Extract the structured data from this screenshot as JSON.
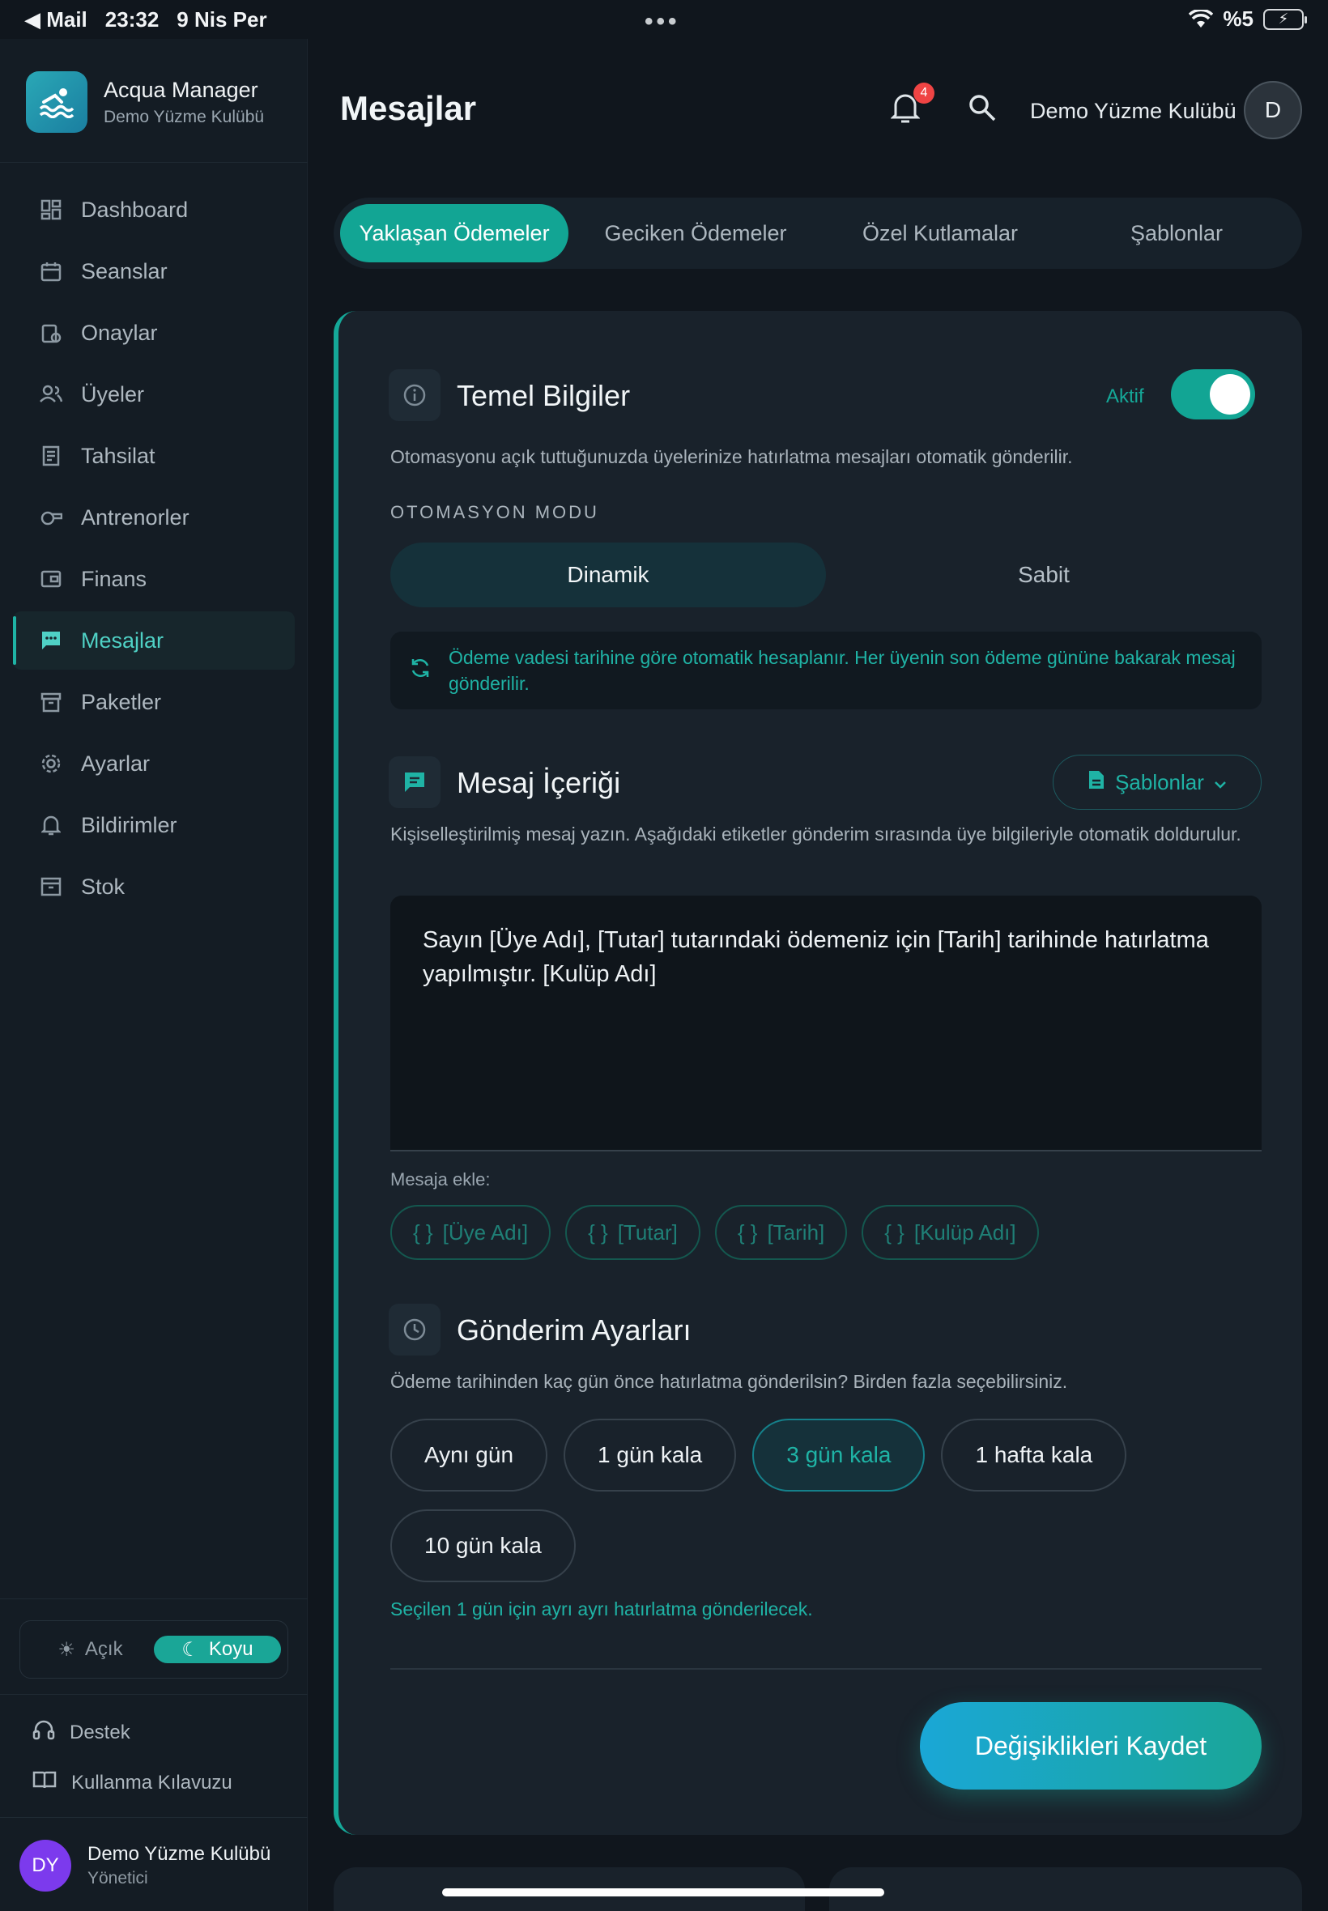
{
  "status_bar": {
    "back_app": "Mail",
    "time": "23:32",
    "date": "9 Nis Per",
    "battery": "%5"
  },
  "brand": {
    "title": "Acqua Manager",
    "subtitle": "Demo Yüzme Kulübü"
  },
  "sidebar": {
    "items": [
      {
        "label": "Dashboard",
        "icon": "dashboard-icon"
      },
      {
        "label": "Seanslar",
        "icon": "calendar-icon"
      },
      {
        "label": "Onaylar",
        "icon": "clipboard-icon"
      },
      {
        "label": "Üyeler",
        "icon": "users-icon"
      },
      {
        "label": "Tahsilat",
        "icon": "receipt-icon"
      },
      {
        "label": "Antrenorler",
        "icon": "whistle-icon"
      },
      {
        "label": "Finans",
        "icon": "wallet-icon"
      },
      {
        "label": "Mesajlar",
        "icon": "message-icon",
        "active": true
      },
      {
        "label": "Paketler",
        "icon": "archive-icon"
      },
      {
        "label": "Ayarlar",
        "icon": "gear-icon"
      },
      {
        "label": "Bildirimler",
        "icon": "bell-icon"
      },
      {
        "label": "Stok",
        "icon": "box-icon"
      }
    ],
    "theme": {
      "light": "Açık",
      "dark": "Koyu",
      "selected": "Koyu"
    },
    "support": "Destek",
    "guide": "Kullanma Kılavuzu",
    "user": {
      "initials": "DY",
      "name": "Demo Yüzme Kulübü",
      "role": "Yönetici"
    }
  },
  "header": {
    "title": "Mesajlar",
    "notification_count": "4",
    "club_name": "Demo Yüzme Kulübü",
    "avatar_initial": "D"
  },
  "tabs": [
    "Yaklaşan Ödemeler",
    "Geciken Ödemeler",
    "Özel Kutlamalar",
    "Şablonlar"
  ],
  "active_tab": "Yaklaşan Ödemeler",
  "basic_info": {
    "title": "Temel Bilgiler",
    "toggle_label": "Aktif",
    "toggle_on": true,
    "description": "Otomasyonu açık tuttuğunuzda üyelerinize hatırlatma mesajları otomatik gönderilir.",
    "mode_label": "OTOMASYON MODU",
    "modes": [
      "Dinamik",
      "Sabit"
    ],
    "selected_mode": "Dinamik",
    "info": "Ödeme vadesi tarihine göre otomatik hesaplanır. Her üyenin son ödeme gününe bakarak mesaj gönderilir."
  },
  "message_content": {
    "title": "Mesaj İçeriği",
    "templates_button": "Şablonlar",
    "description": "Kişiselleştirilmiş mesaj yazın. Aşağıdaki etiketler gönderim sırasında üye bilgileriyle otomatik doldurulur.",
    "text": "Sayın [Üye Adı], [Tutar] tutarındaki ödemeniz için [Tarih] tarihinde hatırlatma yapılmıştır. [Kulüp Adı]",
    "add_label": "Mesaja ekle:",
    "tags": [
      "[Üye Adı]",
      "[Tutar]",
      "[Tarih]",
      "[Kulüp Adı]"
    ]
  },
  "send_settings": {
    "title": "Gönderim Ayarları",
    "description": "Ödeme tarihinden kaç gün önce hatırlatma gönderilsin? Birden fazla seçebilirsiniz.",
    "options": [
      "Aynı gün",
      "1 gün kala",
      "3 gün kala",
      "1 hafta kala",
      "10 gün kala"
    ],
    "selected": [
      "3 gün kala"
    ],
    "hint": "Seçilen 1 gün için ayrı ayrı hatırlatma gönderilecek."
  },
  "save_button": "Değişiklikleri Kaydet",
  "colors": {
    "accent": "#12a594",
    "background": "#10161d",
    "card": "#19222b",
    "badge": "#ef4444"
  }
}
